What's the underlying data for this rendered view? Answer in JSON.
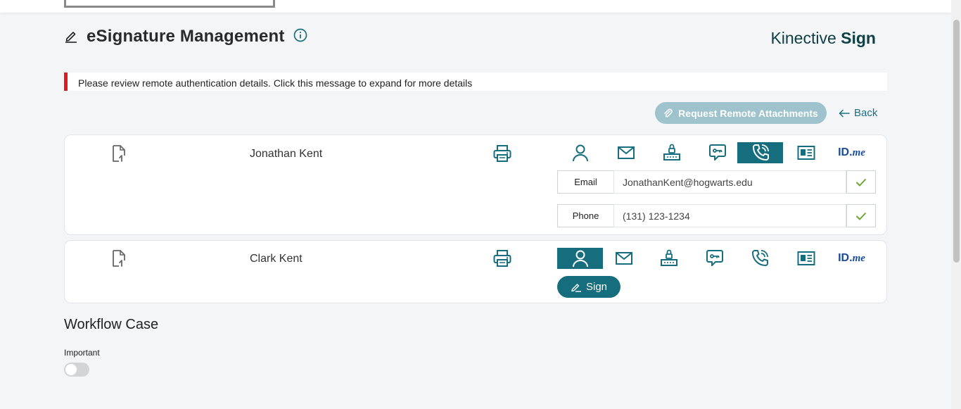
{
  "header": {
    "title": "eSignature Management",
    "brand_light": "Kinective ",
    "brand_bold": "Sign"
  },
  "alert": {
    "message": "Please review remote authentication details. Click this message to expand for more details"
  },
  "actions": {
    "request_attachments_label": "Request Remote Attachments",
    "back_label": "Back",
    "sign_label": "Sign"
  },
  "auth_methods": [
    "user-icon",
    "email-icon",
    "router-icon",
    "chat-key-icon",
    "phone-icon",
    "id-card-icon",
    "idme-logo"
  ],
  "idme": {
    "id": "ID.",
    "me": "me"
  },
  "signers": [
    {
      "name": "Jonathan Kent",
      "active_method": "phone-icon",
      "fields": [
        {
          "label": "Email",
          "value": "JonathanKent@hogwarts.edu",
          "verified": true
        },
        {
          "label": "Phone",
          "value": "(131) 123-1234",
          "verified": true
        }
      ]
    },
    {
      "name": "Clark Kent",
      "active_method": "user-icon"
    }
  ],
  "workflow": {
    "title": "Workflow Case",
    "important_label": "Important",
    "important_on": false
  },
  "colors": {
    "accent": "#156d7d",
    "alert": "#e01b22",
    "disabled_button": "#9ec3cc",
    "check": "#6aa82e"
  }
}
